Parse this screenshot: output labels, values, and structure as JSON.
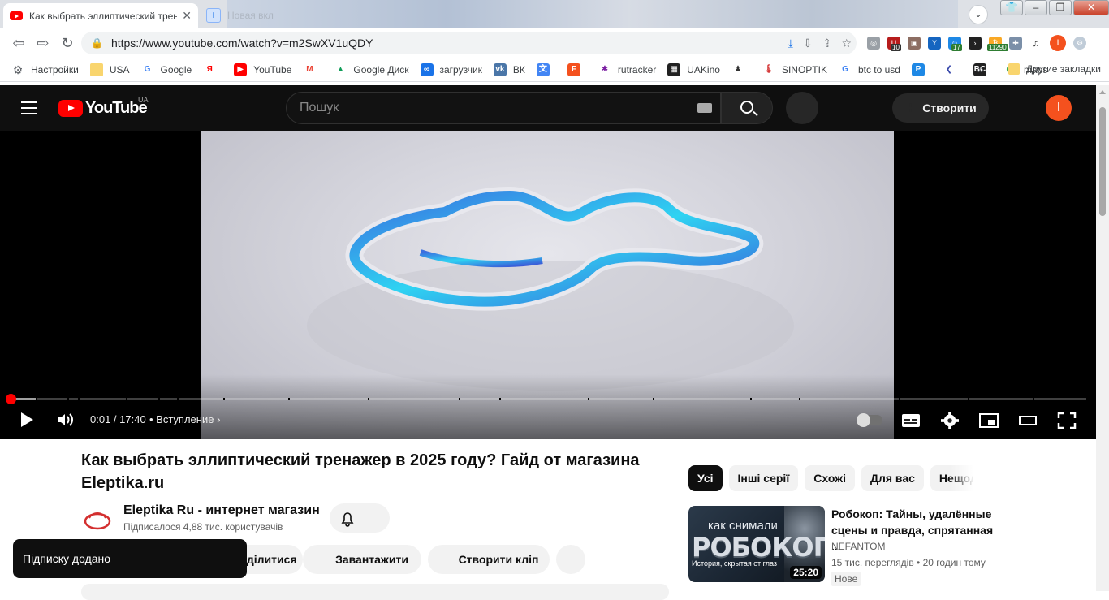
{
  "browser": {
    "tabs": [
      {
        "title": "Как выбрать эллиптический трен",
        "active": true
      },
      {
        "title": "Новая вкл",
        "active": false
      }
    ],
    "url": "https://www.youtube.com/watch?v=m2SwXV1uQDY",
    "extension_badges": [
      "10",
      "17",
      "11290"
    ],
    "bookmarks": [
      "Настройки",
      "USA",
      "Google",
      "YouTube",
      "Gmail",
      "Google Диск",
      "загрузчик",
      "ВК",
      "Переводчик",
      "F",
      "rutracker",
      "UAKino",
      "",
      "SINOPTIK",
      "btc to usd",
      "P",
      "",
      "BC",
      "maps"
    ],
    "bookmarks_overflow": "»",
    "other_bookmarks": "Другие закладки",
    "profile_initial": "I"
  },
  "youtube": {
    "logo_text": "YouTube",
    "country_code": "UA",
    "search_placeholder": "Пошук",
    "create_label": "Створити",
    "avatar_initial": "I"
  },
  "player": {
    "time": "0:01 / 17:40",
    "chapter": "• Вступление",
    "progress_played": 0.001,
    "progress_loaded": 0.024
  },
  "video": {
    "title": "Как выбрать эллиптический тренажер в 2025 году? Гайд от магазина Eleptika.ru",
    "channel": "Eleptika Ru - интернет магазин",
    "subscribers": "Підписалося 4,88 тис. користувачів",
    "actions": [
      "Поділитися",
      "Завантажити",
      "Створити кліп"
    ]
  },
  "toast": "Підписку додано",
  "chips": [
    {
      "label": "Усі",
      "active": true
    },
    {
      "label": "Інші серії",
      "active": false
    },
    {
      "label": "Схожі",
      "active": false
    },
    {
      "label": "Для вас",
      "active": false
    },
    {
      "label": "Нещодавно завантажені",
      "active": false
    }
  ],
  "recommendation": {
    "thumb_line1": "как снимали",
    "thumb_line2": "РОБОКОП",
    "thumb_line3": "История, скрытая от глаз",
    "duration": "25:20",
    "title": "Робокоп: Тайны, удалённые сцены и правда, спрятанная ...",
    "channel": "NEFANTOM",
    "meta": "15 тис. переглядів • 20 годин тому",
    "badge": "Нове"
  }
}
